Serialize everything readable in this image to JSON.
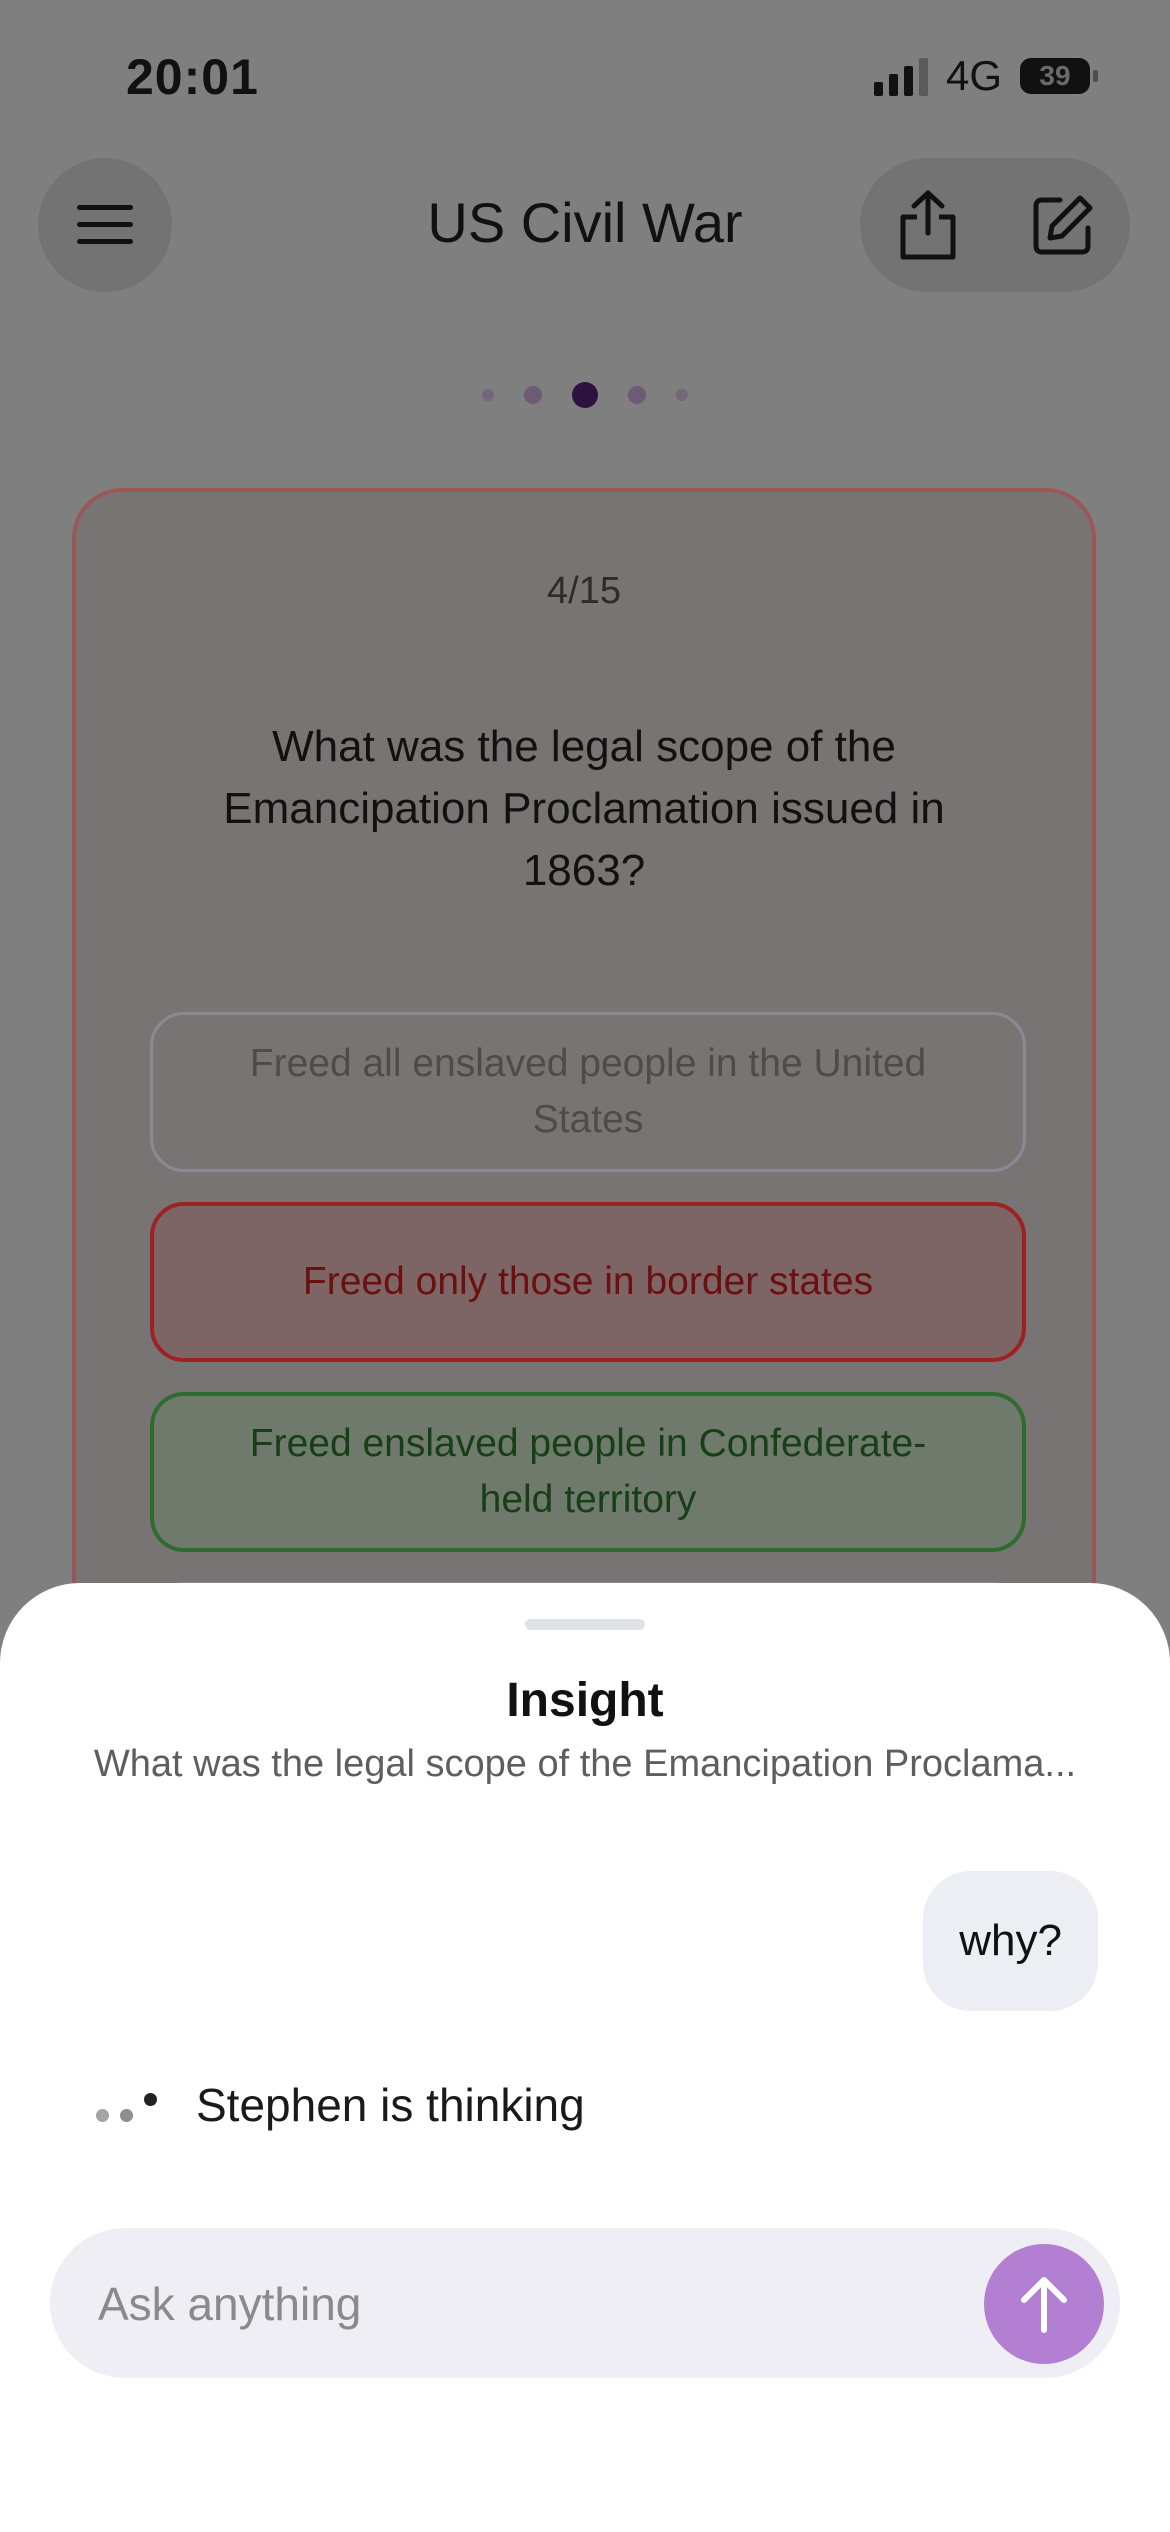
{
  "status_bar": {
    "time": "20:01",
    "network": "4G",
    "battery": "39"
  },
  "header": {
    "title": "US Civil War"
  },
  "pager": {
    "count": 5,
    "active": 3
  },
  "quiz": {
    "counter": "4/15",
    "question": "What was the legal scope of the Emancipation Proclamation issued in 1863?",
    "options": [
      {
        "text": "Freed all enslaved people in the United States",
        "state": "neutral"
      },
      {
        "text": "Freed only those in border states",
        "state": "wrong"
      },
      {
        "text": "Freed enslaved people in Confederate-held territory",
        "state": "correct"
      }
    ]
  },
  "sheet": {
    "title": "Insight",
    "subtitle": "What was the legal scope of the Emancipation Proclama...",
    "user_message": "why?",
    "thinking_text": "Stephen is thinking",
    "input_placeholder": "Ask anything"
  },
  "colors": {
    "accent": "#b37fd2",
    "wrong": "#9e2222",
    "correct": "#2e6b2e"
  }
}
